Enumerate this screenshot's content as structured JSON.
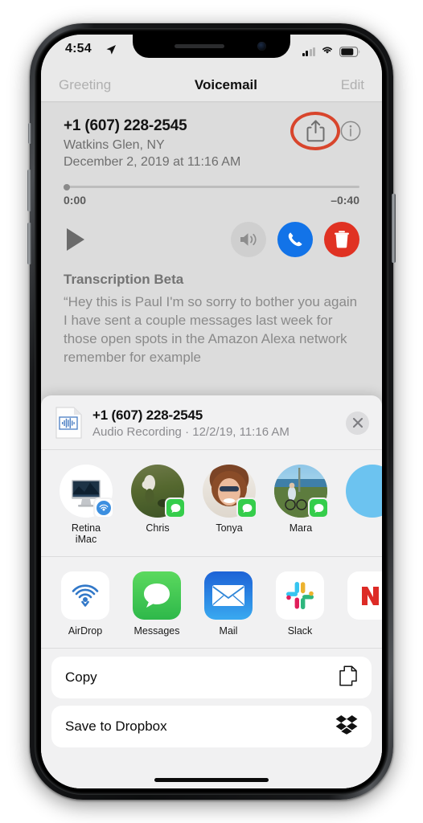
{
  "status_bar": {
    "time": "4:54",
    "location_icon": "location-arrow-icon",
    "signal_icon": "cellular-signal-icon",
    "wifi_icon": "wifi-icon",
    "battery_icon": "battery-icon"
  },
  "nav_bar": {
    "left_label": "Greeting",
    "title": "Voicemail",
    "right_label": "Edit"
  },
  "voicemail": {
    "number": "+1 (607) 228-2545",
    "location": "Watkins Glen, NY",
    "datetime": "December 2, 2019 at 11:16 AM",
    "share_icon": "share-icon",
    "info_icon": "info-icon",
    "elapsed_time": "0:00",
    "remaining_time": "–0:40",
    "scrub_progress_percent": 0,
    "play_icon": "play-icon",
    "speaker_icon": "speaker-icon",
    "callback_icon": "phone-icon",
    "delete_icon": "trash-icon",
    "transcription_title": "Transcription Beta",
    "transcription_text": "“Hey this is Paul I'm so sorry to bother you again I have sent a couple messages last week for those open spots in the Amazon Alexa network remember for example"
  },
  "share_sheet": {
    "file_icon": "audio-file-icon",
    "file_title": "+1 (607) 228-2545",
    "file_subtitle": "Audio Recording · 12/2/19, 11:16 AM",
    "close_icon": "close-icon",
    "contacts": [
      {
        "label": "Retina\niMac",
        "badge": "airdrop-badge-icon",
        "photo": "ph-imac"
      },
      {
        "label": "Chris",
        "badge": "messages-badge-icon",
        "photo": "ph-chris"
      },
      {
        "label": "Tonya",
        "badge": "messages-badge-icon",
        "photo": "ph-tonya"
      },
      {
        "label": "Mara",
        "badge": "messages-badge-icon",
        "photo": "ph-mara"
      },
      {
        "label": "",
        "badge": "",
        "photo": "ph-blue"
      }
    ],
    "apps": [
      {
        "label": "AirDrop",
        "icon": "airdrop-icon"
      },
      {
        "label": "Messages",
        "icon": "messages-icon"
      },
      {
        "label": "Mail",
        "icon": "mail-icon"
      },
      {
        "label": "Slack",
        "icon": "slack-icon"
      },
      {
        "label": "",
        "icon": "partial-app-icon"
      }
    ],
    "actions": [
      {
        "label": "Copy",
        "icon": "copy-icon"
      },
      {
        "label": "Save to Dropbox",
        "icon": "dropbox-icon"
      }
    ]
  },
  "colors": {
    "accent_blue": "#1273e8",
    "delete_red": "#e03223",
    "messages_green": "#35cd4b",
    "highlight_annotation": "#d8452c",
    "screen_background": "#dcdcdc",
    "sheet_background": "#f1f1f2"
  }
}
